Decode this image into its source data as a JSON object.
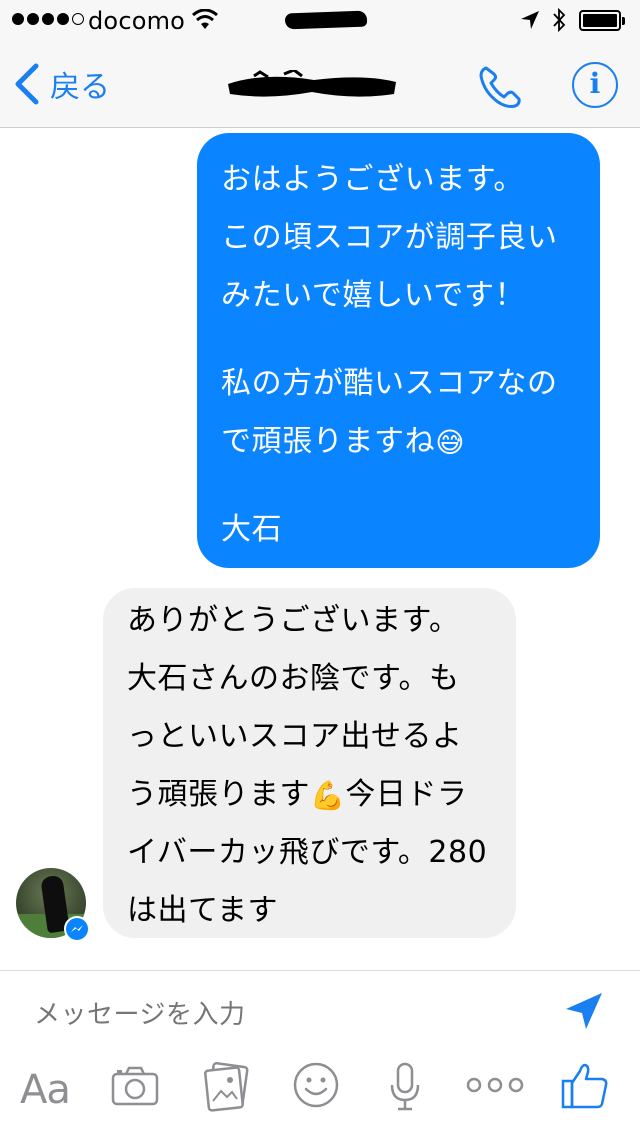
{
  "status_bar": {
    "carrier": "docomo",
    "signal_bars_filled": 4,
    "signal_bars_total": 5,
    "battery_level": 1.0
  },
  "nav": {
    "back_label": "戻る",
    "icons": [
      "chevron-left-icon",
      "phone-icon",
      "info-icon"
    ],
    "info_glyph": "i",
    "accent_color": "#1a7ff0"
  },
  "messages": {
    "outgoing": {
      "lines": [
        "おはようございます。",
        "この頃スコアが調子良い",
        "みたいで嬉しいです！",
        "",
        "私の方が酷いスコアなの",
        "で頑張りますね",
        "",
        "大石"
      ],
      "emoji": "😅",
      "color": "#0a84ff"
    },
    "incoming": {
      "lines": [
        "ありがとうございます。",
        "大石さんのお陰です。も",
        "っといいスコア出せるよ",
        "う頑張ります",
        "イバーカッ飛びです。280",
        "は出てます"
      ],
      "line4_suffix": "今日ドラ",
      "emoji": "💪",
      "color": "#f0f0f0"
    }
  },
  "compose": {
    "placeholder": "メッセージを入力",
    "aa_label": "Aa",
    "toolbar_icons": [
      "text-format-icon",
      "camera-icon",
      "gallery-icon",
      "emoji-icon",
      "microphone-icon",
      "more-icon",
      "thumbs-up-icon"
    ]
  }
}
